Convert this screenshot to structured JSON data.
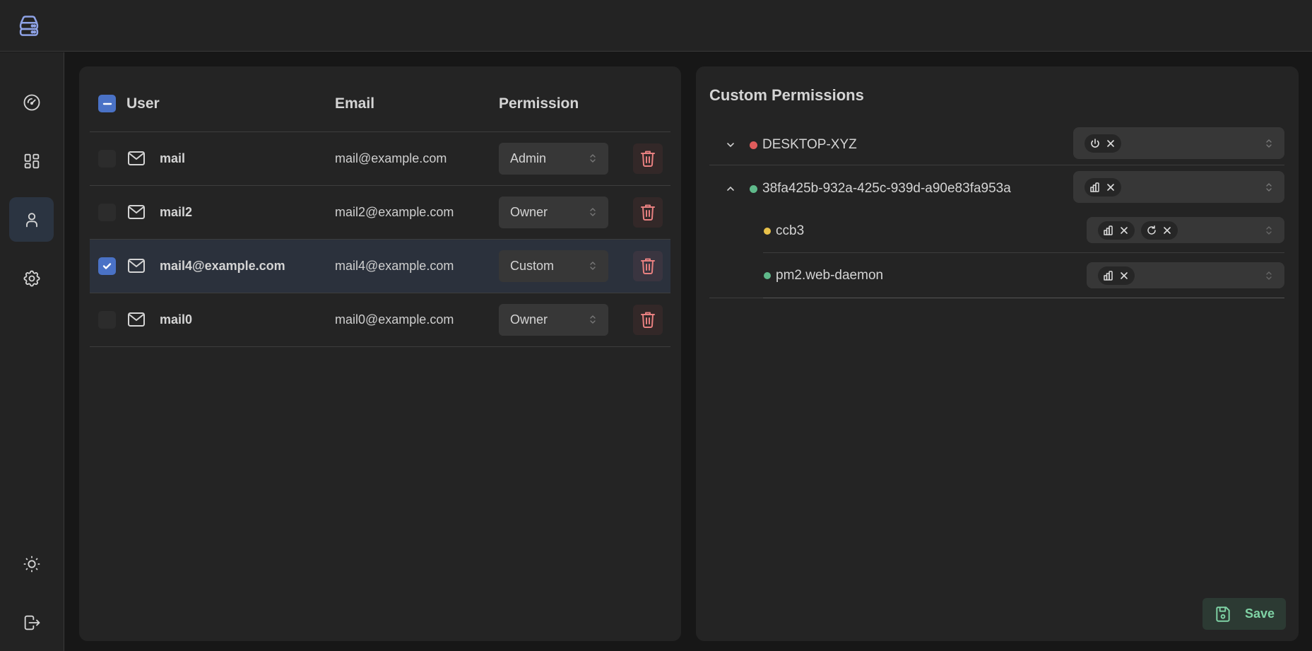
{
  "app": {
    "logo_icon": "server-stack-icon"
  },
  "sidebar": {
    "items": [
      {
        "name": "dashboard",
        "icon": "gauge-icon",
        "active": false
      },
      {
        "name": "apps",
        "icon": "layout-grid-icon",
        "active": false
      },
      {
        "name": "users",
        "icon": "user-icon",
        "active": true
      },
      {
        "name": "settings",
        "icon": "gear-icon",
        "active": false
      }
    ],
    "bottom": [
      {
        "name": "theme-toggle",
        "icon": "sun-icon"
      },
      {
        "name": "logout",
        "icon": "logout-icon"
      }
    ]
  },
  "users_table": {
    "headers": {
      "user": "User",
      "email": "Email",
      "permission": "Permission"
    },
    "select_all_state": "indeterminate",
    "rows": [
      {
        "name": "mail",
        "email": "mail@example.com",
        "permission": "Admin",
        "checked": false
      },
      {
        "name": "mail2",
        "email": "mail2@example.com",
        "permission": "Owner",
        "checked": false
      },
      {
        "name": "mail4@example.com",
        "email": "mail4@example.com",
        "permission": "Custom",
        "checked": true
      },
      {
        "name": "mail0",
        "email": "mail0@example.com",
        "permission": "Owner",
        "checked": false
      }
    ]
  },
  "custom_permissions": {
    "title": "Custom Permissions",
    "nodes": [
      {
        "label": "DESKTOP-XYZ",
        "status_color": "#e05c5c",
        "expanded": false,
        "permissions": [
          "power-icon"
        ]
      },
      {
        "label": "38fa425b-932a-425c-939d-a90e83fa953a",
        "status_color": "#5fb98a",
        "expanded": true,
        "permissions": [
          "bar-chart-icon"
        ],
        "children": [
          {
            "label": "ccb3",
            "status_color": "#e8c14a",
            "permissions": [
              "bar-chart-icon",
              "refresh-icon"
            ]
          },
          {
            "label": "pm2.web-daemon",
            "status_color": "#5fb98a",
            "permissions": [
              "bar-chart-icon"
            ]
          }
        ]
      }
    ],
    "save_label": "Save"
  },
  "colors": {
    "accent": "#4a72c6",
    "danger": "#e88080",
    "success": "#7fd3a5",
    "selected_row": "#2b313c"
  }
}
